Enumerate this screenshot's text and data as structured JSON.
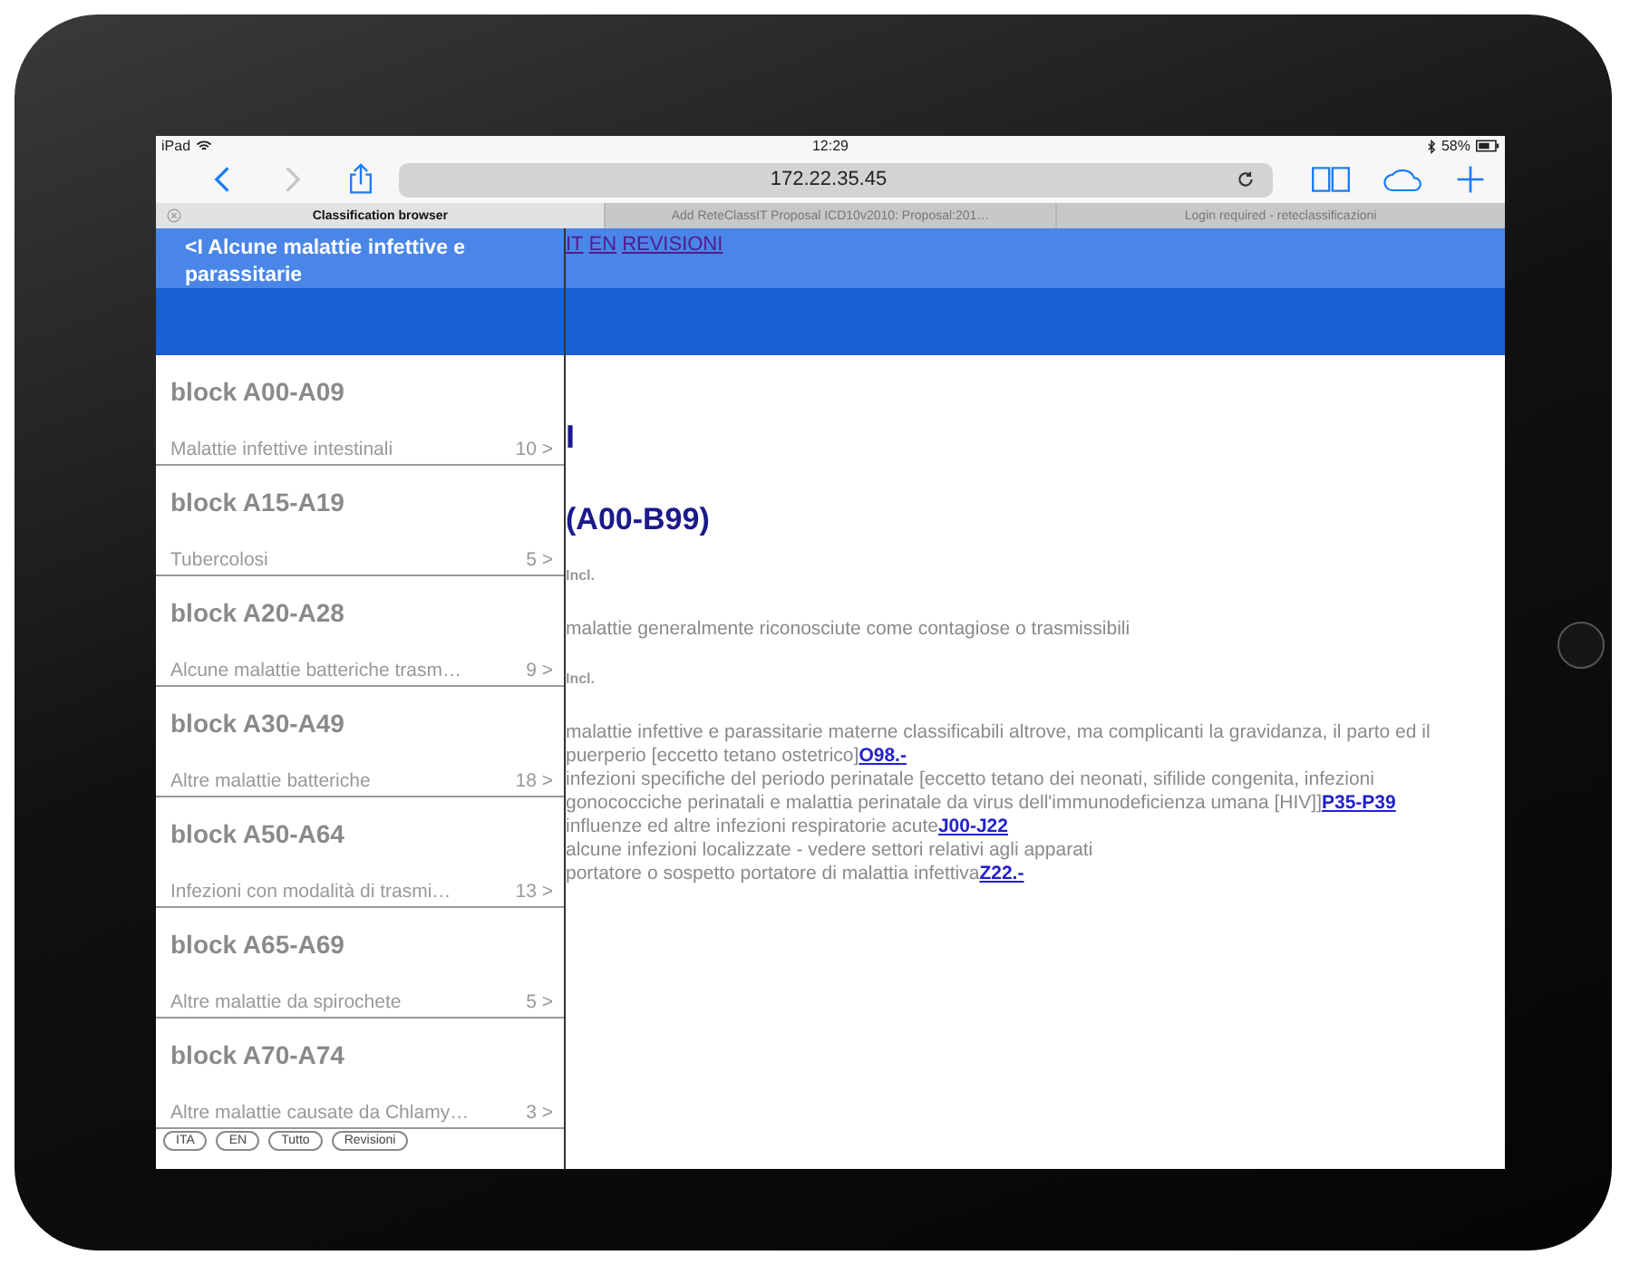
{
  "status_bar": {
    "device": "iPad",
    "time": "12:29",
    "battery": "58%"
  },
  "toolbar": {
    "url": "172.22.35.45"
  },
  "tabs": [
    {
      "label": "Classification browser",
      "selected": true
    },
    {
      "label": "Add ReteClassIT Proposal ICD10v2010: Proposal:201…",
      "selected": false
    },
    {
      "label": "Login required - reteclassificazioni",
      "selected": false
    }
  ],
  "sidebar": {
    "header": "<I Alcune malattie infettive e parassitarie",
    "items": [
      {
        "title": "block A00-A09",
        "subtitle": "Malattie infettive intestinali",
        "count": "10 >"
      },
      {
        "title": "block A15-A19",
        "subtitle": "Tubercolosi",
        "count": "5 >"
      },
      {
        "title": "block A20-A28",
        "subtitle": "Alcune malattie batteriche trasm…",
        "count": "9 >"
      },
      {
        "title": "block A30-A49",
        "subtitle": "Altre malattie batteriche",
        "count": "18 >"
      },
      {
        "title": "block A50-A64",
        "subtitle": "Infezioni con modalità di trasmi…",
        "count": "13 >"
      },
      {
        "title": "block A65-A69",
        "subtitle": "Altre malattie da spirochete",
        "count": "5 >"
      },
      {
        "title": "block A70-A74",
        "subtitle": "Altre malattie causate da Chlamy…",
        "count": "3 >"
      }
    ],
    "buttons": [
      "ITA",
      "EN",
      "Tutto",
      "Revisioni"
    ]
  },
  "main": {
    "nav_links": [
      "IT",
      "EN",
      "REVISIONI"
    ],
    "chapter": "I",
    "range": "(A00-B99)",
    "sections": [
      {
        "label": "Incl.",
        "lines": [
          {
            "text": "malattie generalmente riconosciute come contagiose o trasmissibili"
          }
        ]
      },
      {
        "label": "Incl.",
        "lines": [
          {
            "text": "malattie infettive e parassitarie materne classificabili altrove, ma complicanti la gravidanza, il parto ed il puerperio [eccetto tetano ostetrico]",
            "link": "O98.-"
          },
          {
            "text": "infezioni specifiche del periodo perinatale [eccetto tetano dei neonati, sifilide congenita, infezioni gonococciche perinatali e malattia perinatale da virus dell'immunodeficienza umana [HIV]]",
            "link": "P35-P39"
          },
          {
            "text": "influenze ed altre infezioni respiratorie acute",
            "link": "J00-J22"
          },
          {
            "text": "alcune infezioni localizzate - vedere settori relativi agli apparati"
          },
          {
            "text": "portatore o sospetto portatore di malattia infettiva",
            "link": "Z22.-"
          }
        ]
      }
    ]
  }
}
